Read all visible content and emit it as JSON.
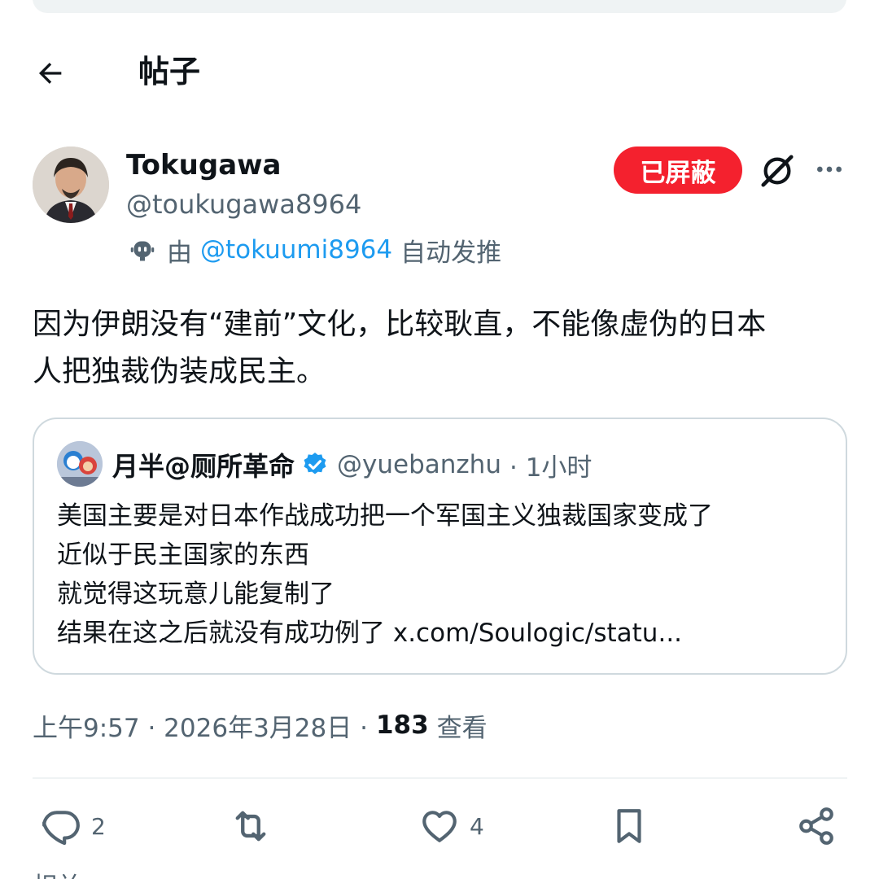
{
  "header": {
    "title": "帖子"
  },
  "author": {
    "name": "Tokugawa",
    "handle": "@toukugawa8964",
    "automated_prefix": "由",
    "automated_link": "@tokuumi8964",
    "automated_suffix": "自动发推"
  },
  "actions_top": {
    "blocked_label": "已屏蔽"
  },
  "post": {
    "text_line1": "因为伊朗没有“建前”文化，比较耿直，不能像虚伪的日本",
    "text_line2": "人把独裁伪装成民主。"
  },
  "quote": {
    "name": "月半@厕所革命",
    "handle": "@yuebanzhu",
    "time": "· 1小时",
    "lines": [
      "美国主要是对日本作战成功把一个军国主义独裁国家变成了",
      "近似于民主国家的东西",
      "就觉得这玩意儿能复制了",
      "结果在这之后就没有成功例了 x.com/Soulogic/statu..."
    ]
  },
  "meta": {
    "time": "上午9:57 · 2026年3月28日 ·",
    "views": "183",
    "views_label": "查看"
  },
  "stats": {
    "replies": "2",
    "likes": "4"
  },
  "bottom_cut_text": "相关",
  "colors": {
    "accent": "#1d9bf0",
    "blocked": "#f4212e",
    "secondary_text": "#536471",
    "border": "#cfd9de"
  },
  "icons": {
    "back": "arrow-left-icon",
    "bot": "bot-icon",
    "grok": "grok-icon",
    "more": "more-horizontal-icon",
    "verified": "verified-badge-icon",
    "reply": "reply-icon",
    "repost": "repost-icon",
    "like": "like-icon",
    "bookmark": "bookmark-icon",
    "share": "share-icon"
  }
}
